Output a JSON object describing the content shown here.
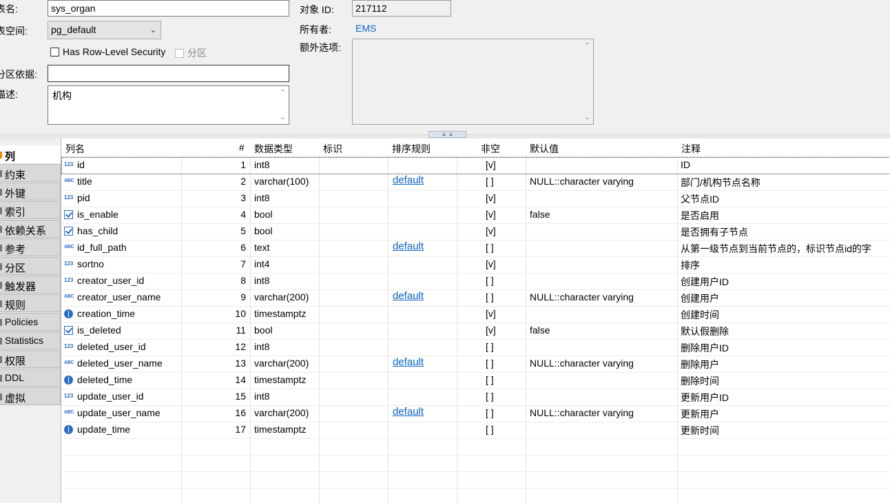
{
  "form": {
    "table_name_label": "表名:",
    "table_name_value": "sys_organ",
    "tablespace_label": "表空间:",
    "tablespace_value": "pg_default",
    "rls_label": "Has Row-Level Security",
    "partition_label": "分区",
    "partition_by_label": "分区依据:",
    "partition_by_value": "",
    "description_label": "描述:",
    "description_value": "机构",
    "object_id_label": "对象 ID:",
    "object_id_value": "217112",
    "owner_label": "所有者:",
    "owner_value": "EMS",
    "extra_options_label": "额外选项:"
  },
  "tabs": [
    "列",
    "约束",
    "外键",
    "索引",
    "依赖关系",
    "参考",
    "分区",
    "触发器",
    "规则",
    "Policies",
    "Statistics",
    "权限",
    "DDL",
    "虚拟"
  ],
  "columns": {
    "headers": [
      "列名",
      "#",
      "数据类型",
      "标识",
      "排序规则",
      "非空",
      "默认值",
      "注释"
    ],
    "rows": [
      {
        "icon": "numeric-key-icon",
        "name": "id",
        "num": "1",
        "type": "int8",
        "collation": "",
        "notnull": "[v]",
        "default": "",
        "comment": "ID"
      },
      {
        "icon": "text-icon",
        "name": "title",
        "num": "2",
        "type": "varchar(100)",
        "collation": "default",
        "notnull": "[ ]",
        "default": "NULL::character varying",
        "comment": "部门/机构节点名称"
      },
      {
        "icon": "numeric-icon",
        "name": "pid",
        "num": "3",
        "type": "int8",
        "collation": "",
        "notnull": "[v]",
        "default": "",
        "comment": "父节点ID"
      },
      {
        "icon": "boolean-icon",
        "name": "is_enable",
        "num": "4",
        "type": "bool",
        "collation": "",
        "notnull": "[v]",
        "default": "false",
        "comment": "是否启用"
      },
      {
        "icon": "boolean-icon",
        "name": "has_child",
        "num": "5",
        "type": "bool",
        "collation": "",
        "notnull": "[v]",
        "default": "",
        "comment": "是否拥有子节点"
      },
      {
        "icon": "text-icon",
        "name": "id_full_path",
        "num": "6",
        "type": "text",
        "collation": "default",
        "notnull": "[ ]",
        "default": "",
        "comment": "从第一级节点到当前节点的，标识节点id的字"
      },
      {
        "icon": "numeric-icon",
        "name": "sortno",
        "num": "7",
        "type": "int4",
        "collation": "",
        "notnull": "[v]",
        "default": "",
        "comment": "排序"
      },
      {
        "icon": "numeric-icon",
        "name": "creator_user_id",
        "num": "8",
        "type": "int8",
        "collation": "",
        "notnull": "[ ]",
        "default": "",
        "comment": "创建用户ID"
      },
      {
        "icon": "text-icon",
        "name": "creator_user_name",
        "num": "9",
        "type": "varchar(200)",
        "collation": "default",
        "notnull": "[ ]",
        "default": "NULL::character varying",
        "comment": "创建用户"
      },
      {
        "icon": "clock-icon",
        "name": "creation_time",
        "num": "10",
        "type": "timestamptz",
        "collation": "",
        "notnull": "[v]",
        "default": "",
        "comment": "创建时间"
      },
      {
        "icon": "boolean-icon",
        "name": "is_deleted",
        "num": "11",
        "type": "bool",
        "collation": "",
        "notnull": "[v]",
        "default": "false",
        "comment": "默认假删除"
      },
      {
        "icon": "numeric-icon",
        "name": "deleted_user_id",
        "num": "12",
        "type": "int8",
        "collation": "",
        "notnull": "[ ]",
        "default": "",
        "comment": "删除用户ID"
      },
      {
        "icon": "text-icon",
        "name": "deleted_user_name",
        "num": "13",
        "type": "varchar(200)",
        "collation": "default",
        "notnull": "[ ]",
        "default": "NULL::character varying",
        "comment": "删除用户"
      },
      {
        "icon": "clock-icon",
        "name": "deleted_time",
        "num": "14",
        "type": "timestamptz",
        "collation": "",
        "notnull": "[ ]",
        "default": "",
        "comment": "删除时间"
      },
      {
        "icon": "numeric-icon",
        "name": "update_user_id",
        "num": "15",
        "type": "int8",
        "collation": "",
        "notnull": "[ ]",
        "default": "",
        "comment": "更新用户ID"
      },
      {
        "icon": "text-icon",
        "name": "update_user_name",
        "num": "16",
        "type": "varchar(200)",
        "collation": "default",
        "notnull": "[ ]",
        "default": "NULL::character varying",
        "comment": "更新用户"
      },
      {
        "icon": "clock-icon",
        "name": "update_time",
        "num": "17",
        "type": "timestamptz",
        "collation": "",
        "notnull": "[ ]",
        "default": "",
        "comment": "更新时间"
      }
    ]
  },
  "colors": {
    "link": "#0b63c4",
    "icon": "#2b6cc4",
    "active_tab_marker": "#f08a00"
  }
}
